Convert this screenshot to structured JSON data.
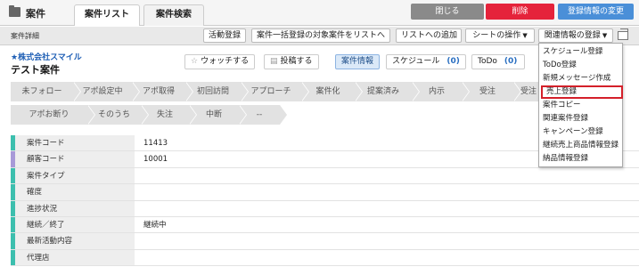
{
  "header": {
    "app_title": "案件",
    "tabs": [
      "案件リスト",
      "案件検索"
    ],
    "buttons": {
      "close": "閉じる",
      "delete": "削除",
      "change": "登録情報の変更"
    }
  },
  "detailbar": {
    "label": "案件詳細",
    "buttons": {
      "activity": "活動登録",
      "bulk": "案件一括登録の対象案件をリストへ",
      "add_list": "リストへの追加",
      "sheet": "シートの操作",
      "related": "関連情報の登録"
    }
  },
  "record": {
    "company": "★株式会社スマイル",
    "title": "テスト案件"
  },
  "actions": {
    "watch": "ウォッチする",
    "post": "投稿する",
    "info": "案件情報",
    "schedule": "スケジュール",
    "schedule_count": "(0)",
    "todo": "ToDo",
    "todo_count": "(0)"
  },
  "statuses_row1": [
    "未フォロー",
    "アポ設定中",
    "アポ取得",
    "初回訪問",
    "アプローチ",
    "案件化",
    "提案済み",
    "内示",
    "受注",
    "受注"
  ],
  "statuses_row2": [
    "アポお断り",
    "そのうち",
    "失注",
    "中断",
    "--"
  ],
  "fields": [
    {
      "label": "案件コード",
      "value": "11413"
    },
    {
      "label": "顧客コード",
      "value": "10001"
    },
    {
      "label": "案件タイプ",
      "value": ""
    },
    {
      "label": "確度",
      "value": ""
    },
    {
      "label": "進捗状況",
      "value": ""
    },
    {
      "label": "継続／終了",
      "value": "継続中"
    },
    {
      "label": "最新活動内容",
      "value": ""
    },
    {
      "label": "代理店",
      "value": ""
    }
  ],
  "menu": {
    "items": [
      "スケジュール登録",
      "ToDo登録",
      "新規メッセージ作成",
      "売上登録",
      "案件コピー",
      "関連案件登録",
      "キャンペーン登録",
      "継続売上商品情報登録",
      "納品情報登録"
    ],
    "highlighted_index": 3
  },
  "colors": {
    "delete": "#e5233b",
    "change": "#4a8fd8",
    "company": "#1f5fb5",
    "highlight": "#d4202a",
    "row_bar": "#3cbfae",
    "row_bar_alt": "#a89ad8"
  }
}
